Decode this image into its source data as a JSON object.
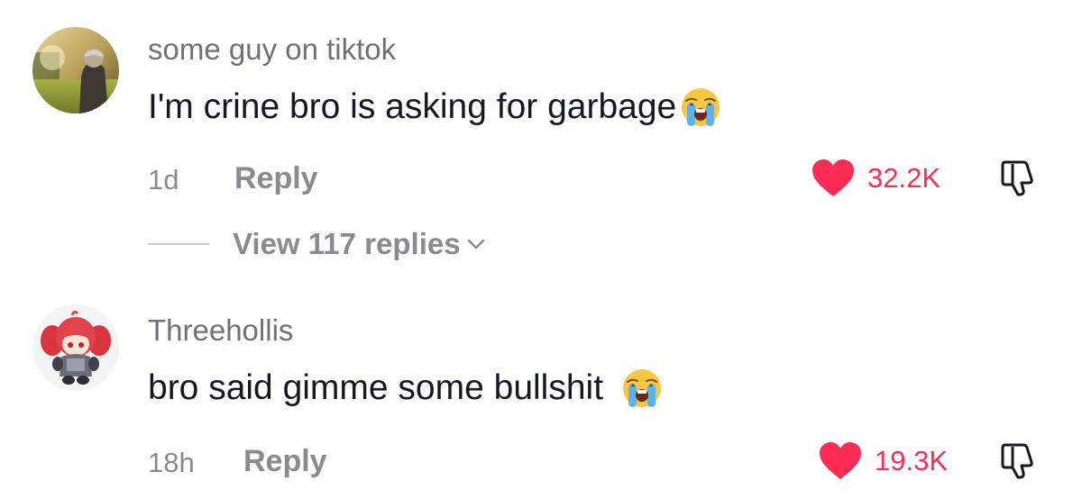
{
  "comments": [
    {
      "username": "some guy on tiktok",
      "text": "I'm crine bro is asking for garbage",
      "emoji": "loudly-crying-face-emoji",
      "time": "1d",
      "reply_label": "Reply",
      "like_count": "32.2K",
      "view_replies": "View 117 replies"
    },
    {
      "username": "Threehollis",
      "text": "bro said gimme some bullshit",
      "emoji": "loudly-crying-face-emoji",
      "time": "18h",
      "reply_label": "Reply",
      "like_count": "19.3K"
    }
  ],
  "colors": {
    "like": "#fe2c55",
    "username": "#6f7078",
    "muted": "#8a8b91",
    "text": "#161823"
  },
  "icons": [
    "heart-icon",
    "dislike-icon",
    "chevron-down-icon",
    "loudly-crying-face-emoji"
  ]
}
